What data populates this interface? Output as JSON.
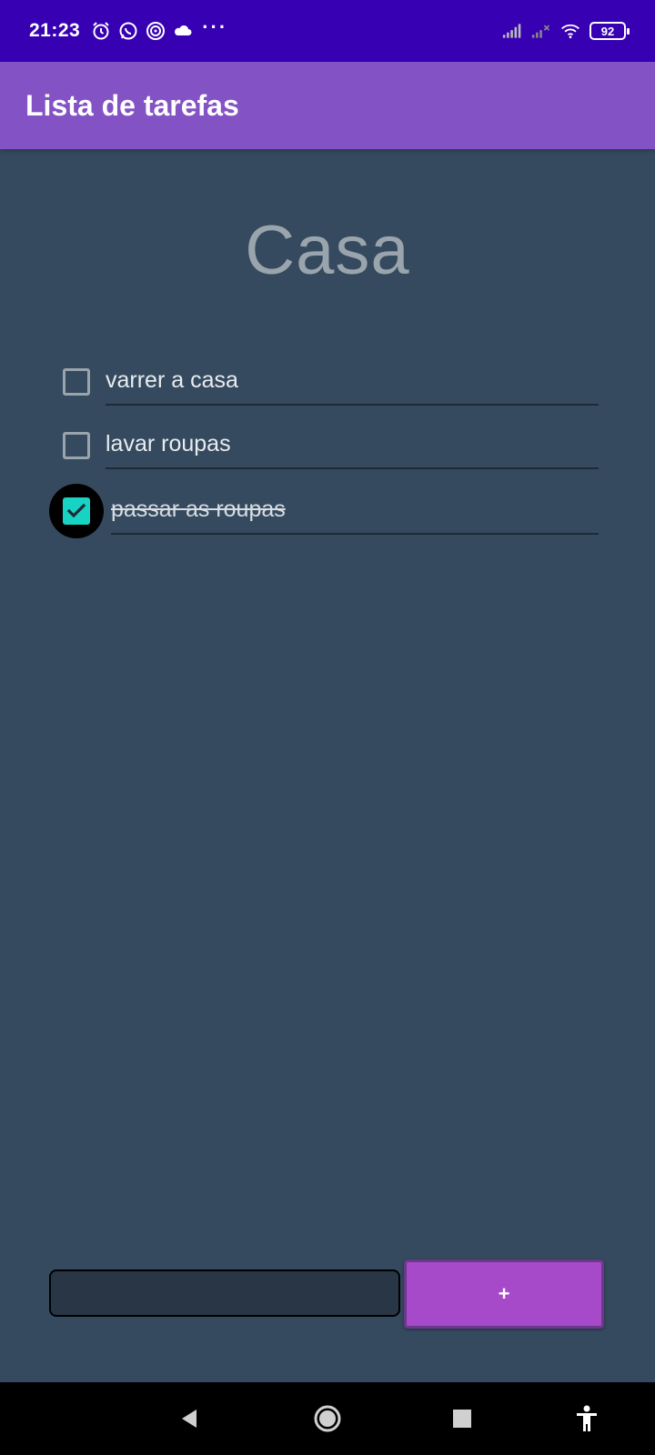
{
  "status_bar": {
    "time": "21:23",
    "battery": "92",
    "icons_left": [
      "alarm-icon",
      "whatsapp-icon",
      "fingerprint-icon",
      "cloud-icon"
    ],
    "more": "···"
  },
  "app_bar": {
    "title": "Lista de tarefas"
  },
  "list": {
    "title": "Casa",
    "tasks": [
      {
        "label": "varrer a casa",
        "checked": false
      },
      {
        "label": "lavar roupas",
        "checked": false
      },
      {
        "label": "passar as roupas",
        "checked": true
      }
    ]
  },
  "composer": {
    "input_value": "",
    "add_label": "+"
  },
  "colors": {
    "status_bar": "#3700b3",
    "app_bar": "#8352c4",
    "background": "#354a5f",
    "checkbox_checked": "#17d3c4",
    "add_button": "#a64ac9"
  }
}
